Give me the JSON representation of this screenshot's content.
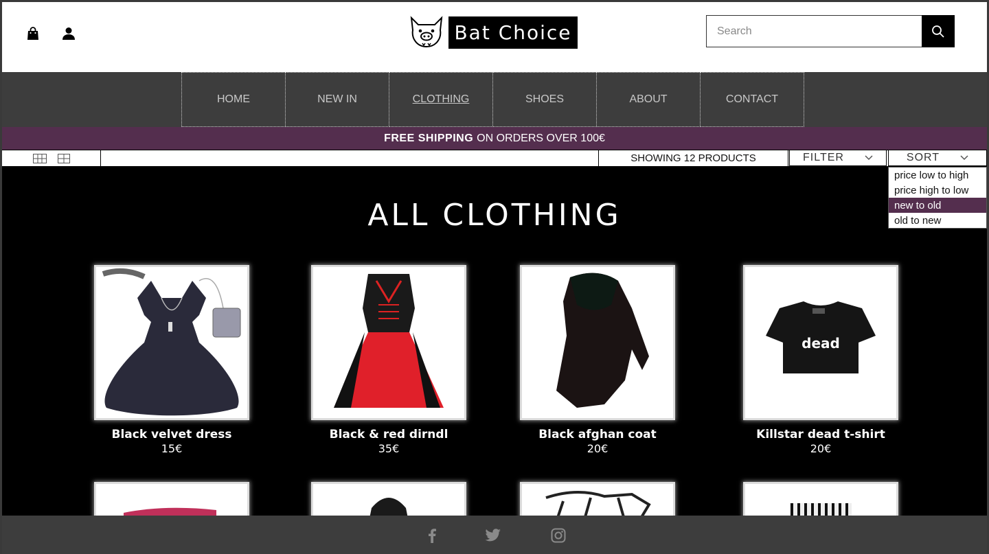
{
  "header": {
    "brand": "Bat Choice",
    "search_placeholder": "Search"
  },
  "nav": {
    "items": [
      {
        "label": "HOME"
      },
      {
        "label": "NEW IN"
      },
      {
        "label": "CLOTHING"
      },
      {
        "label": "SHOES"
      },
      {
        "label": "ABOUT"
      },
      {
        "label": "CONTACT"
      }
    ],
    "active": "CLOTHING"
  },
  "banner": {
    "strong": "FREE SHIPPING",
    "rest": "ON ORDERS OVER 100€"
  },
  "toolbar": {
    "count": "SHOWING 12 PRODUCTS",
    "filter_label": "FILTER",
    "sort_label": "SORT",
    "sort_options": [
      "price low to high",
      "price high to low",
      "new to old",
      "old to new"
    ],
    "sort_selected": "new to old"
  },
  "main": {
    "title": "ALL CLOTHING",
    "products": [
      {
        "name": "Black velvet dress",
        "price": "15€"
      },
      {
        "name": "Black & red dirndl",
        "price": "35€"
      },
      {
        "name": "Black afghan coat",
        "price": "20€"
      },
      {
        "name": "Killstar dead t-shirt",
        "price": "20€",
        "print": "dead"
      }
    ]
  },
  "colors": {
    "accent": "#542e4e",
    "nav_bg": "#3d3d3d",
    "page_bg": "#000000"
  },
  "icons": {
    "header": [
      "shopping-bag-icon",
      "user-icon",
      "search-icon"
    ],
    "toolbar": [
      "grid-3-icon",
      "grid-2-icon",
      "chevron-down-icon"
    ],
    "footer": [
      "facebook-icon",
      "twitter-icon",
      "instagram-icon"
    ]
  }
}
